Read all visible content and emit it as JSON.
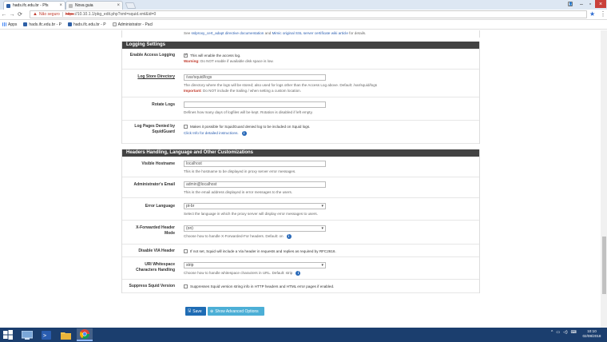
{
  "browser": {
    "tabs": [
      {
        "label": "hads.ifc.edu.br - Pfs"
      },
      {
        "label": "Nova guia"
      }
    ],
    "omnibox": {
      "security_label": "Não seguro",
      "scheme": "https",
      "rest": "://10.10.1.1/pkg_edit.php?xml=squid.xml&id=0"
    },
    "bookmarks": [
      {
        "label": "Apps"
      },
      {
        "label": "hads.ifc.edu.br - P"
      },
      {
        "label": "hads.ifc.edu.br - P"
      },
      {
        "label": "Administrator - Pacl"
      }
    ]
  },
  "top_help": {
    "prefix": "See ",
    "link1": "sslproxy_cert_adapt directive documentation",
    "mid": " and ",
    "link2": "Mimic original SSL server certificate wiki article",
    "suffix": " for details."
  },
  "logging": {
    "title": "Logging Settings",
    "access_log": {
      "label": "Enable Access Logging",
      "checkbox_text": "This will enable the access log.",
      "warning_prefix": "Warning:",
      "warning_text": " Do NOT enable if available disk space is low."
    },
    "log_dir": {
      "label": "Log Store Directory",
      "value": "/var/squid/logs",
      "help_text": "The directory where the logs will be stored; also used for logs other than the Access Log above. Default: /var/squid/logs",
      "important_prefix": "Important:",
      "important_text": " Do NOT include the trailing / when setting a custom location."
    },
    "rotate": {
      "label": "Rotate Logs",
      "value": "",
      "help_text": "Defines how many days of logfiles will be kept. Rotation is disabled if left empty."
    },
    "squidguard": {
      "label_line1": "Log Pages Denied by",
      "label_line2": "SquidGuard",
      "checkbox_text": "Makes it possible for SquidGuard denied log to be included on Squid logs.",
      "link_text": "Click Info for detailed instructions."
    }
  },
  "headers": {
    "title": "Headers Handling, Language and Other Customizations",
    "hostname": {
      "label": "Visible Hostname",
      "value": "localhost",
      "help_text": "This is the hostname to be displayed in proxy server error messages."
    },
    "admin_email": {
      "label": "Administrator's Email",
      "value": "admin@localhost",
      "help_text": "This is the email address displayed in error messages to the users."
    },
    "error_lang": {
      "label": "Error Language",
      "value": "pt-br",
      "help_text": "Select the language in which the proxy server will display error messages to users."
    },
    "xff": {
      "label_line1": "X-Forwarded Header",
      "label_line2": "Mode",
      "value": "(on)",
      "help_text": "Choose how to handle X-Forwarded-For headers. Default: on"
    },
    "via": {
      "label": "Disable VIA Header",
      "checkbox_text": "If not set, Squid will include a Via header in requests and replies as required by RFC2616."
    },
    "uri_ws": {
      "label_line1": "URI Whitespace",
      "label_line2": "Characters Handling",
      "value": "strip",
      "help_text": "Choose how to handle whitespace characters in URL. Default: strip"
    },
    "suppress": {
      "label": "Suppress Squid Version",
      "checkbox_text": "Suppresses Squid version string info in HTTP headers and HTML error pages if enabled."
    }
  },
  "buttons": {
    "save": "Save",
    "advanced": "Show Advanced Options"
  },
  "taskbar": {
    "time": "10:10",
    "date": "02/08/2018"
  },
  "colors": {
    "panel_header": "#424242",
    "save_button": "#1f6cb4",
    "advanced_button": "#4cafd6",
    "warning": "#c0392b",
    "link": "#2a5db0",
    "taskbar": "#1b3e6e"
  }
}
